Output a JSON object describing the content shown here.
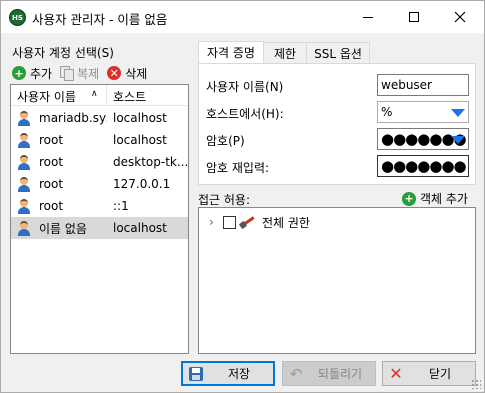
{
  "window": {
    "title": "사용자 관리자 - 이름 없음",
    "app_icon_text": "HS"
  },
  "left": {
    "label": "사용자 계정 선택(S)",
    "toolbar": {
      "add": "추가",
      "copy": "복제",
      "delete": "삭제"
    },
    "columns": [
      "사용자 이름",
      "호스트"
    ],
    "sort_indicator": "∧",
    "users": [
      {
        "name": "mariadb.sys",
        "host": "localhost",
        "selected": false
      },
      {
        "name": "root",
        "host": "localhost",
        "selected": false
      },
      {
        "name": "root",
        "host": "desktop-tk...",
        "selected": false
      },
      {
        "name": "root",
        "host": "127.0.0.1",
        "selected": false
      },
      {
        "name": "root",
        "host": "::1",
        "selected": false
      },
      {
        "name": "이름 없음",
        "host": "localhost",
        "selected": true
      }
    ]
  },
  "tabs": [
    {
      "label": "자격 증명",
      "active": true
    },
    {
      "label": "제한",
      "active": false
    },
    {
      "label": "SSL 옵션",
      "active": false
    }
  ],
  "credentials": {
    "username_label": "사용자 이름(N)",
    "username_value": "webuser",
    "host_label": "호스트에서(H):",
    "host_value": "%",
    "password_label": "암호(P)",
    "password_value": "●●●●●●●",
    "confirm_label": "암호 재입력:",
    "confirm_value": "●●●●●●●"
  },
  "access": {
    "label": "접근 허용:",
    "add_object": "객체 추가",
    "tree": [
      {
        "label": "전체 권한",
        "checked": false,
        "expanded": false
      }
    ]
  },
  "buttons": {
    "save": "저장",
    "revert": "되돌리기",
    "close": "닫기"
  },
  "colors": {
    "accent": "#0078d7",
    "add_green": "#2a9d3a",
    "delete_red": "#d9302e"
  }
}
